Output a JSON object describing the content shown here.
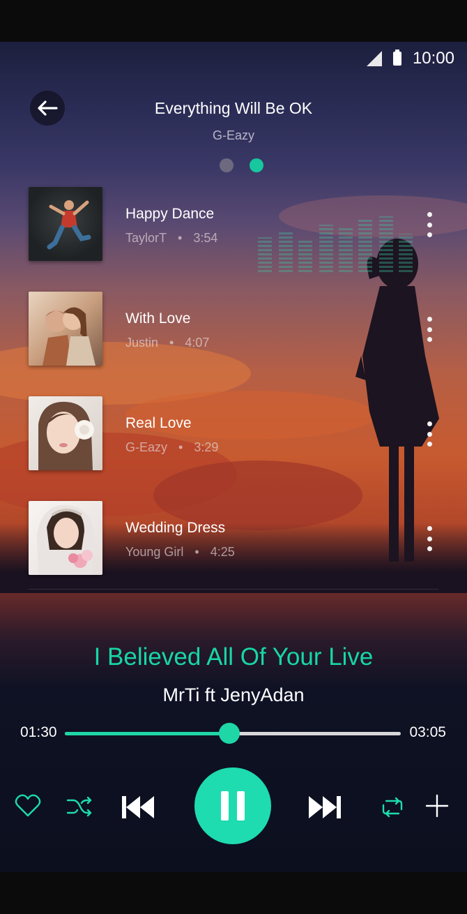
{
  "status_bar": {
    "time": "10:00",
    "signal_icon": "signal-icon",
    "battery_icon": "battery-icon"
  },
  "header": {
    "title": "Everything Will Be OK",
    "artist": "G-Eazy",
    "pager": {
      "count": 2,
      "active_index": 1
    }
  },
  "tracks": [
    {
      "title": "Happy Dance",
      "artist": "TaylorT",
      "duration": "3:54"
    },
    {
      "title": "With Love",
      "artist": "Justin",
      "duration": "4:07"
    },
    {
      "title": "Real Love",
      "artist": "G-Eazy",
      "duration": "3:29"
    },
    {
      "title": "Wedding Dress",
      "artist": "Young Girl",
      "duration": "4:25"
    }
  ],
  "now_playing": {
    "title": "I Believed All Of Your Live",
    "artist": "MrTi ft JenyAdan",
    "current_time": "01:30",
    "total_time": "03:05",
    "progress": 0.49
  },
  "colors": {
    "accent": "#1edbb0",
    "text": "#ffffff",
    "muted": "#b9b6c8"
  },
  "controls": [
    "heart-icon",
    "shuffle-icon",
    "previous-icon",
    "pause-icon",
    "next-icon",
    "repeat-icon",
    "add-icon"
  ]
}
